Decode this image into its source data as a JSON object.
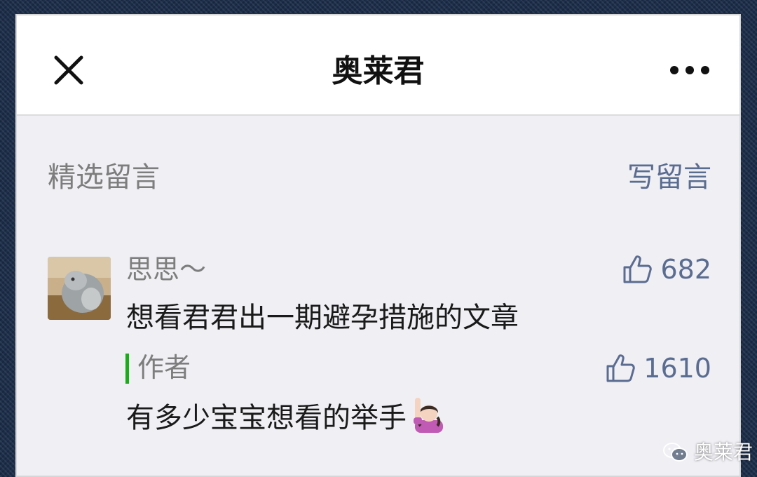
{
  "nav": {
    "title": "奥莱君",
    "close_icon": "close-icon",
    "more_icon": "more-icon"
  },
  "section": {
    "title": "精选留言",
    "write_label": "写留言"
  },
  "comment": {
    "nickname": "思思～",
    "text": "想看君君出一期避孕措施的文章",
    "likes": "682",
    "reply": {
      "label": "作者",
      "text": "有多少宝宝想看的举手",
      "likes": "1610",
      "emoji": "raising-hand-emoji"
    }
  },
  "watermark": {
    "text": "奥莱君",
    "icon": "wechat-icon"
  },
  "colors": {
    "link": "#5b6c91",
    "reply_bar": "#1aad19",
    "background": "#efeff4"
  }
}
